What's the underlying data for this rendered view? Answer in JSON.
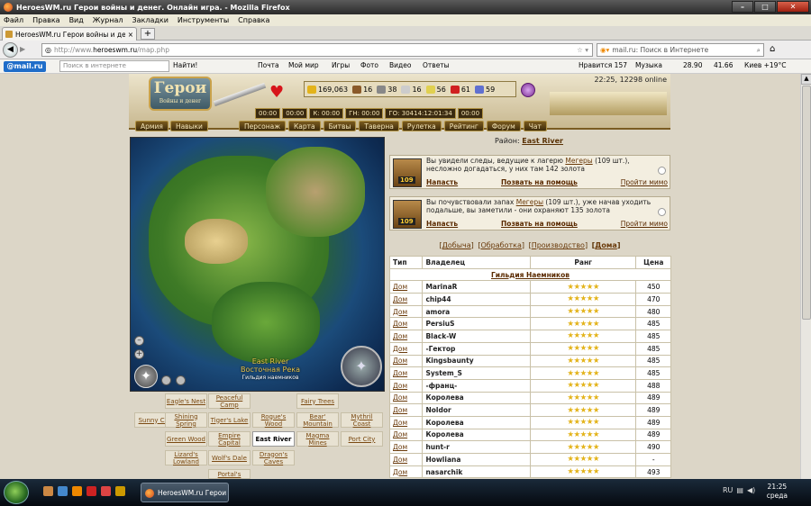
{
  "window": {
    "title": "HeroesWM.ru Герои войны и денег. Онлайн игра. - Mozilla Firefox"
  },
  "menu": [
    "Файл",
    "Правка",
    "Вид",
    "Журнал",
    "Закладки",
    "Инструменты",
    "Справка"
  ],
  "tab": {
    "label": "HeroesWM.ru Герои войны и денег. Онла...",
    "close": "×",
    "new": "+"
  },
  "url": {
    "prefix": "http://www.",
    "host": "heroeswm.ru",
    "path": "/map.php"
  },
  "search": {
    "placeholder": "mail.ru: Поиск в Интернете"
  },
  "mailbar": {
    "logo": "@mail.ru",
    "search_placeholder": "Поиск в интернете",
    "go": "Найти!",
    "items": [
      "Почта",
      "Мой мир",
      "Игры",
      "Фото",
      "Видео",
      "Ответы"
    ],
    "likes": "Нравится 157",
    "music": "Музыка",
    "usd": "28.90",
    "eur": "41.66",
    "weather": "Киев +19°C"
  },
  "game": {
    "logo": "Герои",
    "logo_sub": "Войны и денег",
    "online": "22:25, 12298 online",
    "resources": [
      {
        "val": "169,063",
        "color": "#e3b31a"
      },
      {
        "val": "16",
        "color": "#8a5a2a"
      },
      {
        "val": "38",
        "color": "#888888"
      },
      {
        "val": "16",
        "color": "#cccccc"
      },
      {
        "val": "56",
        "color": "#e0d050"
      },
      {
        "val": "61",
        "color": "#d02020"
      },
      {
        "val": "59",
        "color": "#6070d0"
      }
    ],
    "timers": [
      "00:00",
      "00:00",
      "К: 00:00",
      "ГН: 00:00",
      "ГО: 30414:12:01:34",
      "00:00"
    ],
    "nav_left": [
      "Армия",
      "Навыки"
    ],
    "nav": [
      "Персонаж",
      "Карта",
      "Битвы",
      "Таверна",
      "Рулетка",
      "Рейтинг",
      "Форум",
      "Чат"
    ]
  },
  "map": {
    "label_name": "East River",
    "label_ru": "Восточная Река",
    "label_sub": "Гильдия наемников",
    "compass": "✦"
  },
  "regions": [
    {
      "name": "Eagle's Nest",
      "col": 1,
      "row": 0
    },
    {
      "name": "Peaceful Camp",
      "col": 2,
      "row": 0
    },
    {
      "name": "Fairy Trees",
      "col": 4,
      "row": 0
    },
    {
      "name": "Sunny City",
      "col": 0,
      "row": 1
    },
    {
      "name": "Shining Spring",
      "col": 1,
      "row": 1
    },
    {
      "name": "Tiger's Lake",
      "col": 2,
      "row": 1
    },
    {
      "name": "Rogue's Wood",
      "col": 3,
      "row": 1
    },
    {
      "name": "Bear' Mountain",
      "col": 4,
      "row": 1
    },
    {
      "name": "Mythril Coast",
      "col": 5,
      "row": 1
    },
    {
      "name": "Green Wood",
      "col": 1,
      "row": 2
    },
    {
      "name": "Empire Capital",
      "col": 2,
      "row": 2
    },
    {
      "name": "East River",
      "col": 3,
      "row": 2,
      "current": true
    },
    {
      "name": "Magma Mines",
      "col": 4,
      "row": 2
    },
    {
      "name": "Port City",
      "col": 5,
      "row": 2
    },
    {
      "name": "Lizard's Lowland",
      "col": 1,
      "row": 3
    },
    {
      "name": "Wolf's Dale",
      "col": 2,
      "row": 3
    },
    {
      "name": "Dragon's Caves",
      "col": 3,
      "row": 3
    },
    {
      "name": "Portal's",
      "col": 2,
      "row": 4
    }
  ],
  "district": {
    "label": "Район:",
    "name": "East River"
  },
  "events": [
    {
      "level": "109",
      "text_pre": "Вы увидели следы, ведущие к лагерю ",
      "link": "Мегеры",
      "text_post": " (109 шт.), несложно догадаться, у них там 142 золота",
      "attack": "Напасть",
      "help": "Позвать на помощь",
      "skip": "Пройти мимо"
    },
    {
      "level": "109",
      "text_pre": "Вы почувствовали запах ",
      "link": "Мегеры",
      "text_post": " (109 шт.), уже начав уходить подальше, вы заметили - они охраняют 135 золота",
      "attack": "Напасть",
      "help": "Позвать на помощь",
      "skip": "Пройти мимо"
    }
  ],
  "filters": [
    "Добыча",
    "Обработка",
    "Производство",
    "Дома"
  ],
  "table": {
    "headers": [
      "Тип",
      "Владелец",
      "Ранг",
      "Цена"
    ],
    "guild": "Гильдия Наемников",
    "rows": [
      {
        "type": "Дом",
        "owner": "MarinaR",
        "rank": "★★★★★",
        "price": "450"
      },
      {
        "type": "Дом",
        "owner": "chip44",
        "rank": "★★★★★",
        "price": "470"
      },
      {
        "type": "Дом",
        "owner": "amora",
        "rank": "★★★★★",
        "price": "480"
      },
      {
        "type": "Дом",
        "owner": "PersiuS",
        "rank": "★★★★★",
        "price": "485"
      },
      {
        "type": "Дом",
        "owner": "Black-W",
        "rank": "★★★★★",
        "price": "485"
      },
      {
        "type": "Дом",
        "owner": "-Гектор",
        "rank": "★★★★★",
        "price": "485"
      },
      {
        "type": "Дом",
        "owner": "Kingsbaunty",
        "rank": "★★★★★",
        "price": "485"
      },
      {
        "type": "Дом",
        "owner": "System_S",
        "rank": "★★★★★",
        "price": "485"
      },
      {
        "type": "Дом",
        "owner": "-франц-",
        "rank": "★★★★★",
        "price": "488"
      },
      {
        "type": "Дом",
        "owner": "Королева",
        "rank": "★★★★★",
        "price": "489"
      },
      {
        "type": "Дом",
        "owner": "Noldor",
        "rank": "★★★★★",
        "price": "489"
      },
      {
        "type": "Дом",
        "owner": "Королева",
        "rank": "★★★★★",
        "price": "489"
      },
      {
        "type": "Дом",
        "owner": "Королева",
        "rank": "★★★★★",
        "price": "489"
      },
      {
        "type": "Дом",
        "owner": "hunt-r",
        "rank": "★★★★★",
        "price": "490"
      },
      {
        "type": "Дом",
        "owner": "Howliana",
        "rank": "★★★★★",
        "price": "-"
      },
      {
        "type": "Дом",
        "owner": "nasarchik",
        "rank": "★★★★★",
        "price": "493"
      }
    ]
  },
  "taskbar": {
    "item": "HeroesWM.ru Герои ...",
    "time": "21:25",
    "day": "среда",
    "lang": "RU"
  }
}
